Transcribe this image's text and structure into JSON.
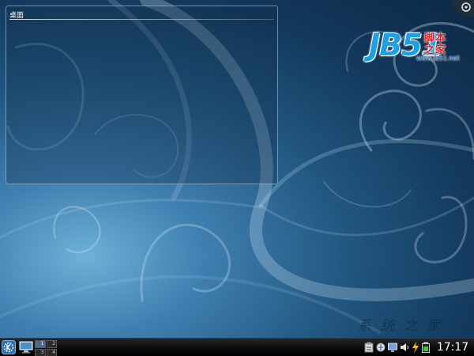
{
  "desktop": {
    "folder_view_title": "桌面",
    "watermark": "系统之家"
  },
  "logo": {
    "jb51": "JB51",
    "cn_line1": "脚本",
    "cn_line2": "之家",
    "url": "www.jb51.net"
  },
  "panel": {
    "pager": [
      {
        "label": "1",
        "active": true
      },
      {
        "label": "2",
        "active": false
      },
      {
        "label": "3",
        "active": false
      },
      {
        "label": "4",
        "active": false
      }
    ],
    "tray_icons": [
      "klipper-icon",
      "network-icon",
      "monitor-icon",
      "volume-icon",
      "device-notifier-icon",
      "battery-icon"
    ],
    "clock": "17:17"
  },
  "colors": {
    "wallpaper_dark": "#0d2845",
    "wallpaper_light": "#6fb0d8",
    "panel": "#0a0a0a",
    "logo_blue": "#1da1e6",
    "logo_red": "#d8272a"
  }
}
